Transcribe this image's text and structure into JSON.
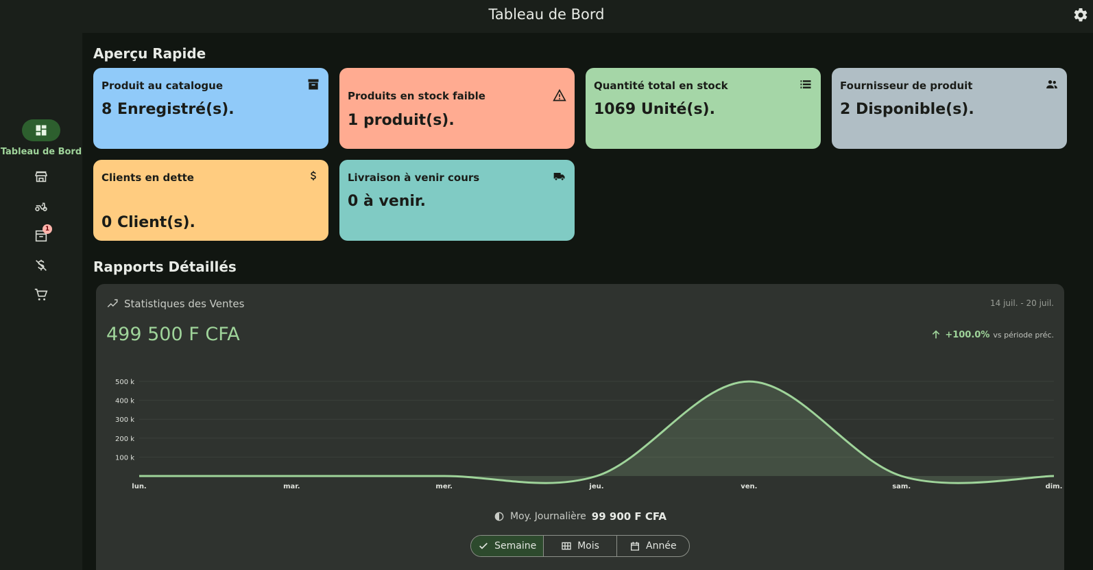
{
  "appbar": {
    "title": "Tableau de Bord"
  },
  "rail": {
    "active_label": "Tableau de Bord",
    "notification_count": "1"
  },
  "overview": {
    "title": "Aperçu Rapide",
    "cards": [
      {
        "label": "Produit au catalogue",
        "value": "8 Enregistré(s).",
        "icon": "archive-icon",
        "color": "#90caf9"
      },
      {
        "label": "Produits en stock faible",
        "value": "1 produit(s).",
        "icon": "warning-icon",
        "color": "#ffab91"
      },
      {
        "label": "Quantité total en stock",
        "value": "1069 Unité(s).",
        "icon": "list-icon",
        "color": "#a5d6a7"
      },
      {
        "label": "Fournisseur de produit",
        "value": "2 Disponible(s).",
        "icon": "people-icon",
        "color": "#b0bec5"
      },
      {
        "label": "Clients en dette",
        "value": "0 Client(s).",
        "icon": "dollar-icon",
        "color": "#ffcc80"
      },
      {
        "label": "Livraison à venir cours",
        "value": "0 à venir.",
        "icon": "truck-icon",
        "color": "#80cbc4"
      }
    ]
  },
  "reports": {
    "title": "Rapports Détaillés",
    "sales": {
      "title": "Statistiques des Ventes",
      "range": "14 juil. - 20 juil.",
      "total": "499 500 F CFA",
      "trend_value": "+100.0%",
      "trend_note": "vs période préc.",
      "avg_label": "Moy. Journalière",
      "avg_value": "99 900 F CFA"
    },
    "periods": [
      {
        "label": "Semaine",
        "selected": true
      },
      {
        "label": "Mois",
        "selected": false
      },
      {
        "label": "Année",
        "selected": false
      }
    ]
  },
  "chart_data": {
    "type": "area",
    "categories": [
      "lun.",
      "mar.",
      "mer.",
      "jeu.",
      "ven.",
      "sam.",
      "dim."
    ],
    "values": [
      0,
      0,
      0,
      0,
      499500,
      0,
      0
    ],
    "y_ticks": [
      "100 k",
      "200 k",
      "300 k",
      "400 k",
      "500 k"
    ],
    "ylim": [
      0,
      500000
    ],
    "grid": true,
    "line_color": "#9fd49a"
  }
}
